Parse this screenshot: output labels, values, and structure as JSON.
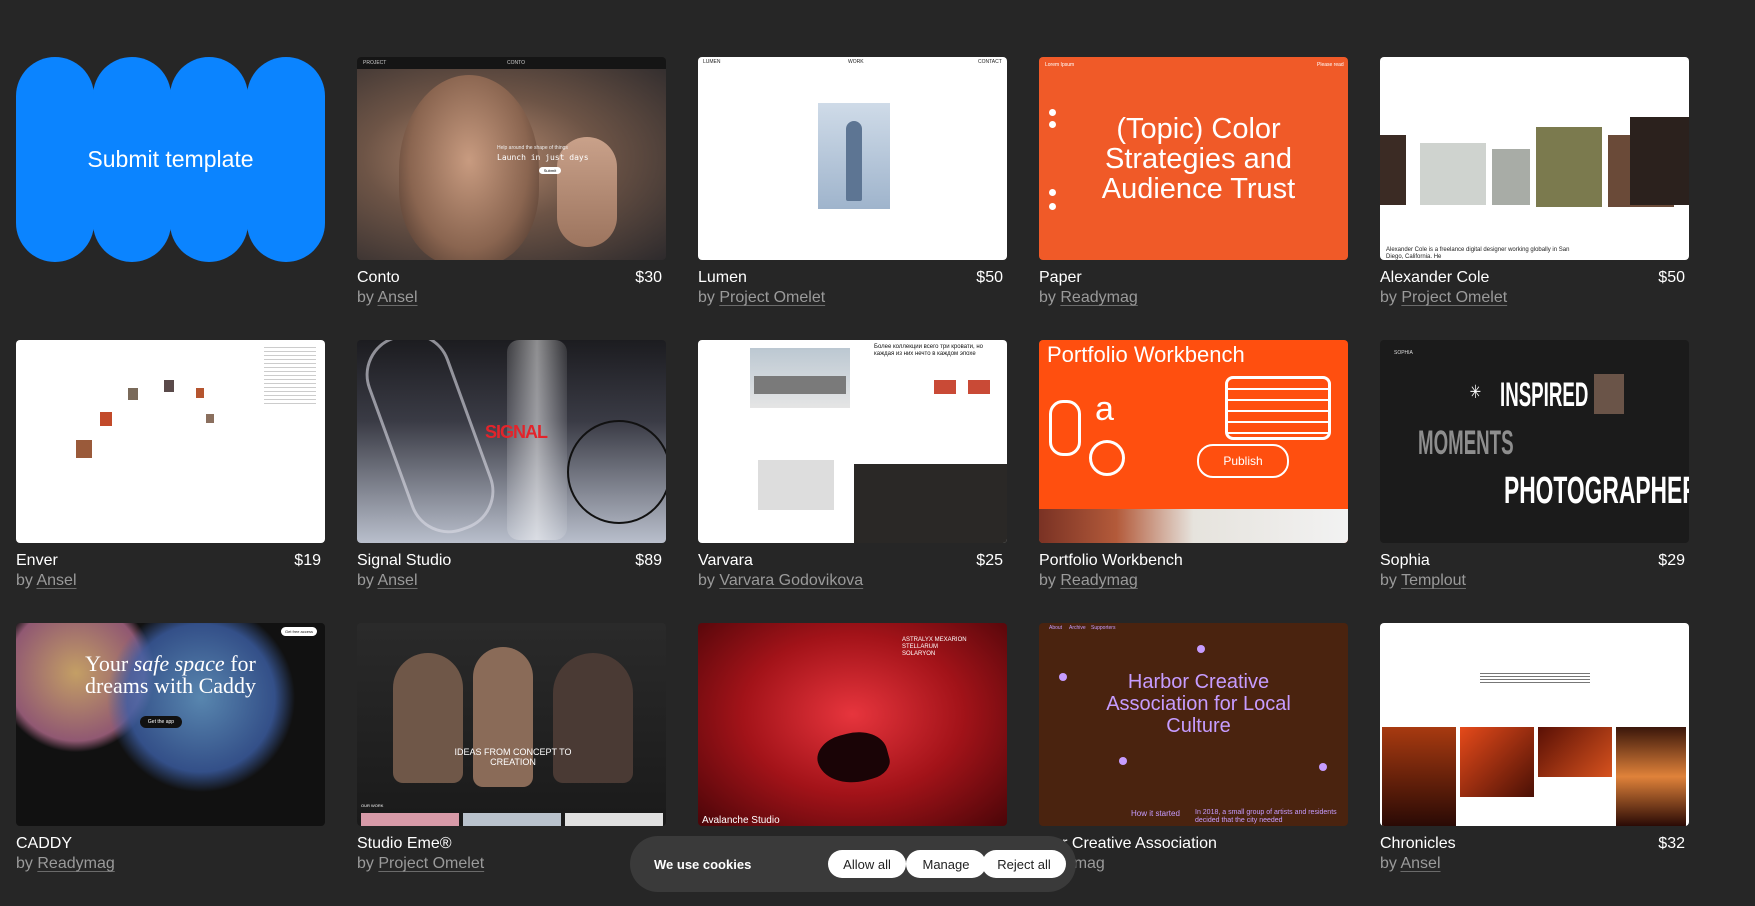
{
  "submit": {
    "label": "Submit template"
  },
  "templates": [
    {
      "title": "Conto",
      "price": "$30",
      "by": "by",
      "author": "Ansel",
      "thumb": {
        "headline": "Launch in just days",
        "kicker": "Help around the shape of things",
        "nav_left": "PROJECT",
        "nav_center": "CONTO",
        "cta": "Submit"
      }
    },
    {
      "title": "Lumen",
      "price": "$50",
      "by": "by",
      "author": "Project Omelet",
      "thumb": {
        "nav_left": "LUMEN",
        "nav_center": "WORK",
        "nav_right": "CONTACT"
      }
    },
    {
      "title": "Paper",
      "price": "",
      "by": "by",
      "author": "Readymag",
      "thumb": {
        "headline": "(Topic) Color Strategies and Audience Trust",
        "nav_left": "Lorem Ipsum",
        "nav_right": "Please read"
      }
    },
    {
      "title": "Alexander Cole",
      "price": "$50",
      "by": "by",
      "author": "Project Omelet",
      "thumb": {
        "caption": "Alexander Cole is a freelance digital designer working globally in San Diego, California. He"
      }
    },
    {
      "title": "Enver",
      "price": "$19",
      "by": "by",
      "author": "Ansel",
      "thumb": {}
    },
    {
      "title": "Signal Studio",
      "price": "$89",
      "by": "by",
      "author": "Ansel",
      "thumb": {
        "headline": "SIGNAL"
      }
    },
    {
      "title": "Varvara",
      "price": "$25",
      "by": "by",
      "author": "Varvara Godovikova",
      "thumb": {
        "headline": "Более коллекции всего три кровати, но каждая из них нечто в каждом эпохе"
      }
    },
    {
      "title": "Portfolio Workbench",
      "price": "",
      "by": "by",
      "author": "Readymag",
      "thumb": {
        "headline": "Portfolio Workbench",
        "cta": "Publish"
      }
    },
    {
      "title": "Sophia",
      "price": "$29",
      "by": "by",
      "author": "Templout",
      "thumb": {
        "line1": "INSPIRED",
        "line2": "MOMENTS",
        "line3": "PHOTOGRAPHER",
        "nav_left": "SOPHIA"
      }
    },
    {
      "title": "CADDY",
      "price": "",
      "by": "by",
      "author": "Readymag",
      "thumb": {
        "headline_a": "Your",
        "headline_em": "safe space",
        "headline_b": "for dreams with Caddy",
        "cta": "Get the app",
        "nav_btn": "Get free access"
      }
    },
    {
      "title": "Studio Eme®",
      "price": "$",
      "by": "by",
      "author": "Project Omelet",
      "thumb": {
        "headline": "IDEAS FROM CONCEPT TO CREATION",
        "section": "OUR WORK"
      }
    },
    {
      "title": "",
      "price": "",
      "by": "",
      "author": "",
      "thumb": {
        "caption": "Avalanche Studio",
        "side": "ASTRALYX MEXARION STELLARUM SOLARYON"
      }
    },
    {
      "title": "rbor Creative Association",
      "price": "",
      "by": "",
      "author": "eadymag",
      "thumb": {
        "headline": "Harbor Creative Association for Local Culture",
        "sub": "How it started",
        "body": "In 2018, a small group of artists and residents decided that the city needed",
        "nav_1": "About",
        "nav_2": "Archive",
        "nav_3": "Supporters"
      }
    },
    {
      "title": "Chronicles",
      "price": "$32",
      "by": "by",
      "author": "Ansel",
      "thumb": {}
    }
  ],
  "cookie": {
    "text": "We use cookies",
    "allow": "Allow all",
    "manage": "Manage",
    "reject": "Reject all"
  },
  "colors": {
    "bg": "#262626",
    "accent": "#0b84ff",
    "orange": "#f05a28"
  }
}
